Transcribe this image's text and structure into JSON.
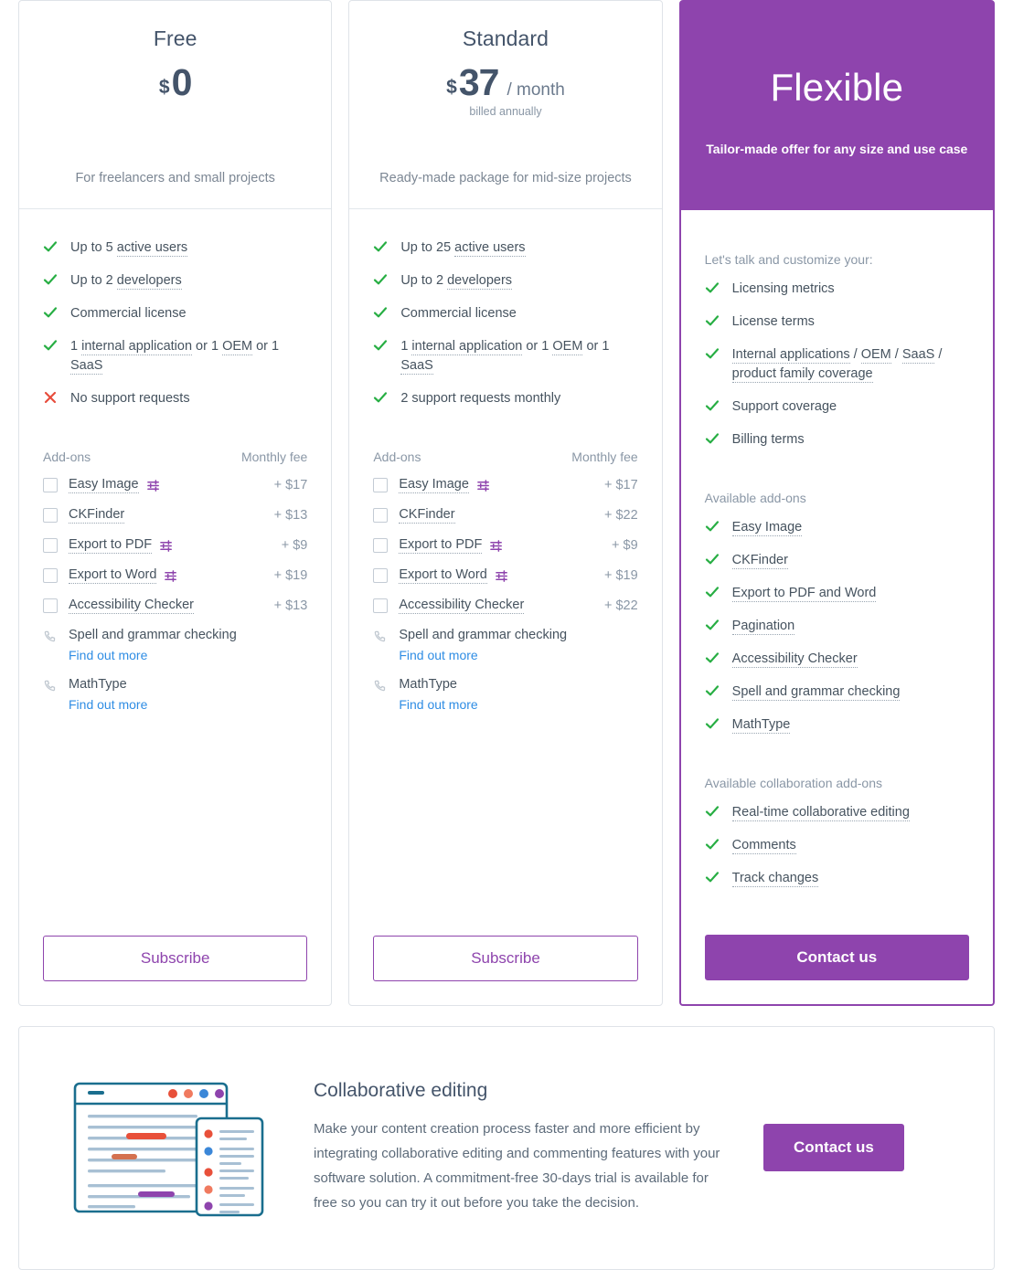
{
  "plans": [
    {
      "id": "free",
      "name": "Free",
      "currency": "$",
      "amount": "0",
      "period": "",
      "billed": "",
      "tagline": "For freelancers and small projects",
      "features": [
        {
          "mark": "check",
          "parts": [
            {
              "text": "Up to 5 ",
              "dotted": false
            },
            {
              "text": "active users",
              "dotted": true
            }
          ]
        },
        {
          "mark": "check",
          "parts": [
            {
              "text": "Up to 2 ",
              "dotted": false
            },
            {
              "text": "developers",
              "dotted": true
            }
          ]
        },
        {
          "mark": "check",
          "parts": [
            {
              "text": "Commercial license",
              "dotted": false
            }
          ]
        },
        {
          "mark": "check",
          "parts": [
            {
              "text": "1 ",
              "dotted": false
            },
            {
              "text": "internal application",
              "dotted": true
            },
            {
              "text": " or 1 ",
              "dotted": false
            },
            {
              "text": "OEM",
              "dotted": true
            },
            {
              "text": " or 1 ",
              "dotted": false
            },
            {
              "text": "SaaS",
              "dotted": true
            }
          ]
        },
        {
          "mark": "cross",
          "parts": [
            {
              "text": "No support requests",
              "dotted": false
            }
          ]
        }
      ],
      "addons_header": {
        "left": "Add-ons",
        "right": "Monthly fee"
      },
      "addons": [
        {
          "label": "Easy Image",
          "sliders": true,
          "fee": "+ $17"
        },
        {
          "label": "CKFinder",
          "sliders": false,
          "fee": "+ $13"
        },
        {
          "label": "Export to PDF",
          "sliders": true,
          "fee": "+ $9"
        },
        {
          "label": "Export to Word",
          "sliders": true,
          "fee": "+ $19"
        },
        {
          "label": "Accessibility Checker",
          "sliders": false,
          "fee": "+ $13"
        }
      ],
      "phone_items": [
        {
          "label": "Spell and grammar checking",
          "link": "Find out more"
        },
        {
          "label": "MathType",
          "link": "Find out more"
        }
      ],
      "cta": {
        "label": "Subscribe",
        "style": "outline"
      }
    },
    {
      "id": "standard",
      "name": "Standard",
      "currency": "$",
      "amount": "37",
      "period": "/ month",
      "billed": "billed annually",
      "tagline": "Ready-made package for mid-size projects",
      "features": [
        {
          "mark": "check",
          "parts": [
            {
              "text": "Up to 25 ",
              "dotted": false
            },
            {
              "text": "active users",
              "dotted": true
            }
          ]
        },
        {
          "mark": "check",
          "parts": [
            {
              "text": "Up to 2 ",
              "dotted": false
            },
            {
              "text": "developers",
              "dotted": true
            }
          ]
        },
        {
          "mark": "check",
          "parts": [
            {
              "text": "Commercial license",
              "dotted": false
            }
          ]
        },
        {
          "mark": "check",
          "parts": [
            {
              "text": "1 ",
              "dotted": false
            },
            {
              "text": "internal application",
              "dotted": true
            },
            {
              "text": " or 1 ",
              "dotted": false
            },
            {
              "text": "OEM",
              "dotted": true
            },
            {
              "text": " or 1 ",
              "dotted": false
            },
            {
              "text": "SaaS",
              "dotted": true
            }
          ]
        },
        {
          "mark": "check",
          "parts": [
            {
              "text": "2 support requests monthly",
              "dotted": false
            }
          ]
        }
      ],
      "addons_header": {
        "left": "Add-ons",
        "right": "Monthly fee"
      },
      "addons": [
        {
          "label": "Easy Image",
          "sliders": true,
          "fee": "+ $17"
        },
        {
          "label": "CKFinder",
          "sliders": false,
          "fee": "+ $22"
        },
        {
          "label": "Export to PDF",
          "sliders": true,
          "fee": "+ $9"
        },
        {
          "label": "Export to Word",
          "sliders": true,
          "fee": "+ $19"
        },
        {
          "label": "Accessibility Checker",
          "sliders": false,
          "fee": "+ $22"
        }
      ],
      "phone_items": [
        {
          "label": "Spell and grammar checking",
          "link": "Find out more"
        },
        {
          "label": "MathType",
          "link": "Find out more"
        }
      ],
      "cta": {
        "label": "Subscribe",
        "style": "outline"
      }
    },
    {
      "id": "flexible",
      "name": "Flexible",
      "featured": true,
      "tagline": "Tailor-made offer for any size and use case",
      "intro": "Let's talk and customize your:",
      "features": [
        {
          "mark": "check",
          "parts": [
            {
              "text": "Licensing metrics",
              "dotted": false
            }
          ]
        },
        {
          "mark": "check",
          "parts": [
            {
              "text": "License terms",
              "dotted": false
            }
          ]
        },
        {
          "mark": "check",
          "parts": [
            {
              "text": "Internal applications",
              "dotted": true
            },
            {
              "text": " / ",
              "dotted": false
            },
            {
              "text": "OEM",
              "dotted": true
            },
            {
              "text": " / ",
              "dotted": false
            },
            {
              "text": "SaaS",
              "dotted": true
            },
            {
              "text": " / ",
              "dotted": false
            },
            {
              "text": "product family coverage",
              "dotted": true
            }
          ]
        },
        {
          "mark": "check",
          "parts": [
            {
              "text": "Support coverage",
              "dotted": false
            }
          ]
        },
        {
          "mark": "check",
          "parts": [
            {
              "text": "Billing terms",
              "dotted": false
            }
          ]
        }
      ],
      "addons_title": "Available add-ons",
      "addon_features": [
        {
          "mark": "check",
          "parts": [
            {
              "text": "Easy Image",
              "dotted": true
            }
          ]
        },
        {
          "mark": "check",
          "parts": [
            {
              "text": "CKFinder",
              "dotted": true
            }
          ]
        },
        {
          "mark": "check",
          "parts": [
            {
              "text": "Export to PDF and Word",
              "dotted": true
            }
          ]
        },
        {
          "mark": "check",
          "parts": [
            {
              "text": "Pagination",
              "dotted": true
            }
          ]
        },
        {
          "mark": "check",
          "parts": [
            {
              "text": "Accessibility Checker",
              "dotted": true
            }
          ]
        },
        {
          "mark": "check",
          "parts": [
            {
              "text": "Spell and grammar checking",
              "dotted": true
            }
          ]
        },
        {
          "mark": "check",
          "parts": [
            {
              "text": "MathType",
              "dotted": true
            }
          ]
        }
      ],
      "collab_title": "Available collaboration add-ons",
      "collab_features": [
        {
          "mark": "check",
          "parts": [
            {
              "text": "Real-time collaborative editing",
              "dotted": true
            }
          ]
        },
        {
          "mark": "check",
          "parts": [
            {
              "text": "Comments",
              "dotted": true
            }
          ]
        },
        {
          "mark": "check",
          "parts": [
            {
              "text": "Track changes",
              "dotted": true
            }
          ]
        }
      ],
      "cta": {
        "label": "Contact us",
        "style": "solid"
      }
    }
  ],
  "promo": {
    "title": "Collaborative editing",
    "body": "Make your content creation process faster and more efficient by integrating collaborative editing and commenting features with your software solution. A commitment-free 30-days trial is available for free so you can try it out before you take the decision.",
    "cta_label": "Contact us"
  },
  "colors": {
    "brand_purple": "#8e44ad",
    "check_green": "#27ae43",
    "cross_red": "#e74c3c",
    "link_blue": "#2f8de4",
    "heading_slate": "#44546a",
    "muted_gray": "#8a97a6",
    "card_border": "#dfe3e8",
    "art_teal": "#1a6e8e",
    "art_red": "#e8503a",
    "art_blue": "#3b87d8",
    "art_purple": "#8e44ad",
    "art_line": "#a8c0d4"
  }
}
